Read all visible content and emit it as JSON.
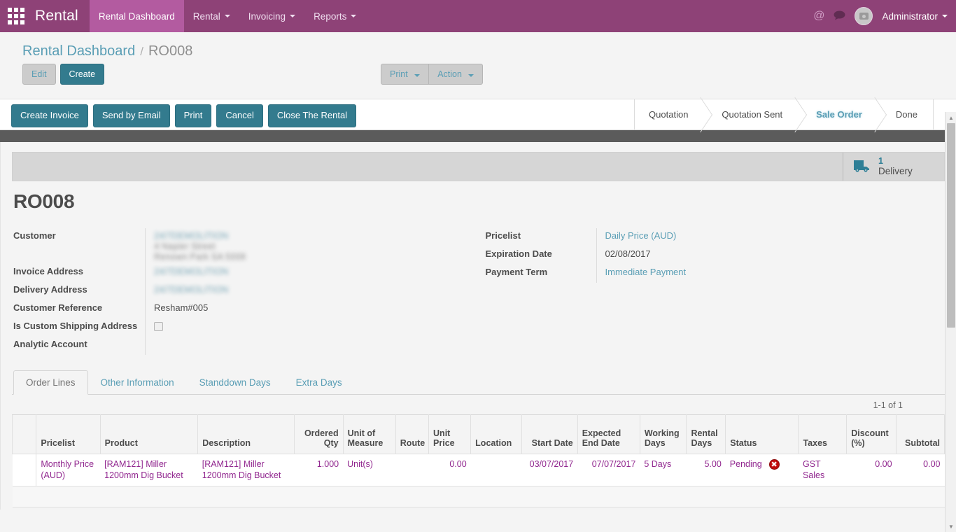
{
  "navbar": {
    "apps_icon": "apps-grid-icon",
    "brand": "Rental",
    "menu": [
      {
        "label": "Rental Dashboard",
        "active": true,
        "caret": false
      },
      {
        "label": "Rental",
        "active": false,
        "caret": true
      },
      {
        "label": "Invoicing",
        "active": false,
        "caret": true
      },
      {
        "label": "Reports",
        "active": false,
        "caret": true
      }
    ],
    "mention_icon": "@",
    "chat_icon": "●",
    "user": "Administrator"
  },
  "breadcrumb": {
    "root": "Rental Dashboard",
    "separator": "/",
    "current": "RO008"
  },
  "control_panel": {
    "edit_label": "Edit",
    "create_label": "Create",
    "print_label": "Print",
    "action_label": "Action"
  },
  "statusbar": {
    "buttons": [
      {
        "label": "Create Invoice"
      },
      {
        "label": "Send by Email"
      },
      {
        "label": "Print"
      },
      {
        "label": "Cancel"
      },
      {
        "label": "Close The Rental"
      }
    ],
    "stages": [
      {
        "label": "Quotation",
        "active": false
      },
      {
        "label": "Quotation Sent",
        "active": false
      },
      {
        "label": "Sale Order",
        "active": true
      },
      {
        "label": "Done",
        "active": false
      }
    ]
  },
  "sheet": {
    "stat_button": {
      "icon": "truck-icon",
      "value": "1",
      "label": "Delivery"
    },
    "title": "RO008",
    "left_fields": [
      {
        "label": "Customer",
        "value": "24/7DEMOLITION",
        "type": "link-redacted",
        "extra_lines": [
          "4 Napier Street",
          "Renown Park SA 5008"
        ]
      },
      {
        "label": "Invoice Address",
        "value": "24/7DEMOLITION",
        "type": "link-redacted"
      },
      {
        "label": "Delivery Address",
        "value": "24/7DEMOLITION",
        "type": "link-redacted"
      },
      {
        "label": "Customer Reference",
        "value": "Resham#005",
        "type": "text"
      },
      {
        "label": "Is Custom Shipping Address",
        "value": "",
        "type": "checkbox",
        "checked": false
      },
      {
        "label": "Analytic Account",
        "value": "",
        "type": "text"
      }
    ],
    "right_fields": [
      {
        "label": "Pricelist",
        "value": "Daily Price (AUD)",
        "type": "link"
      },
      {
        "label": "Expiration Date",
        "value": "02/08/2017",
        "type": "text"
      },
      {
        "label": "Payment Term",
        "value": "Immediate Payment",
        "type": "link"
      }
    ]
  },
  "notebook": {
    "tabs": [
      {
        "label": "Order Lines",
        "active": true
      },
      {
        "label": "Other Information",
        "active": false
      },
      {
        "label": "Standdown Days",
        "active": false
      },
      {
        "label": "Extra Days",
        "active": false
      }
    ],
    "pager": "1-1 of 1",
    "table": {
      "columns": [
        {
          "label": "Pricelist",
          "align": "left"
        },
        {
          "label": "Product",
          "align": "left"
        },
        {
          "label": "Description",
          "align": "left"
        },
        {
          "label": "Ordered Qty",
          "align": "right"
        },
        {
          "label": "Unit of Measure",
          "align": "left"
        },
        {
          "label": "Route",
          "align": "left"
        },
        {
          "label": "Unit Price",
          "align": "right"
        },
        {
          "label": "Location",
          "align": "left"
        },
        {
          "label": "Start Date",
          "align": "right"
        },
        {
          "label": "Expected End Date",
          "align": "right"
        },
        {
          "label": "Working Days",
          "align": "left"
        },
        {
          "label": "Rental Days",
          "align": "right"
        },
        {
          "label": "Status",
          "align": "left"
        },
        {
          "label": "Taxes",
          "align": "left"
        },
        {
          "label": "Discount (%)",
          "align": "right"
        },
        {
          "label": "Subtotal",
          "align": "right"
        }
      ],
      "rows": [
        {
          "pricelist": "Monthly Price (AUD)",
          "product": "[RAM121] Miller 1200mm Dig Bucket",
          "description": "[RAM121] Miller 1200mm Dig Bucket",
          "ordered_qty": "1.000",
          "uom": "Unit(s)",
          "route": "",
          "unit_price": "0.00",
          "location": "",
          "start_date": "03/07/2017",
          "expected_end_date": "07/07/2017",
          "working_days": "5 Days",
          "rental_days": "5.00",
          "status": "Pending",
          "delete_icon": "✖",
          "taxes": "GST Sales",
          "discount": "0.00",
          "subtotal": "0.00"
        }
      ]
    }
  },
  "colors": {
    "brand_purple": "#8e4277",
    "brand_purple_active": "#b35ba0",
    "accent_teal": "#5a9eb5",
    "primary_button": "#337b8e",
    "row_text": "#91278f",
    "delete_red": "#c10d0d"
  }
}
